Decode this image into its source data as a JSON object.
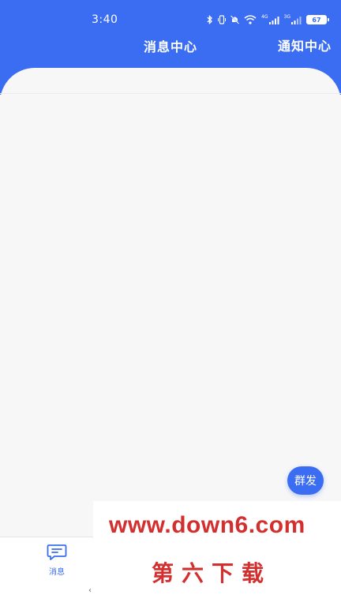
{
  "status_bar": {
    "time": "3:40",
    "network_label": "4G",
    "network_label_2": "3G",
    "battery": "67"
  },
  "header": {
    "title": "消息中心",
    "right_action": "通知中心",
    "color": "#3b6df2"
  },
  "fab": {
    "label": "群发"
  },
  "tabbar": {
    "items": [
      {
        "label": "消息",
        "icon": "message-icon",
        "active": true
      }
    ],
    "back_glyph": "‹"
  },
  "watermark": {
    "url": "www.down6.com",
    "text": "第六下载",
    "color": "#d42f2f"
  }
}
